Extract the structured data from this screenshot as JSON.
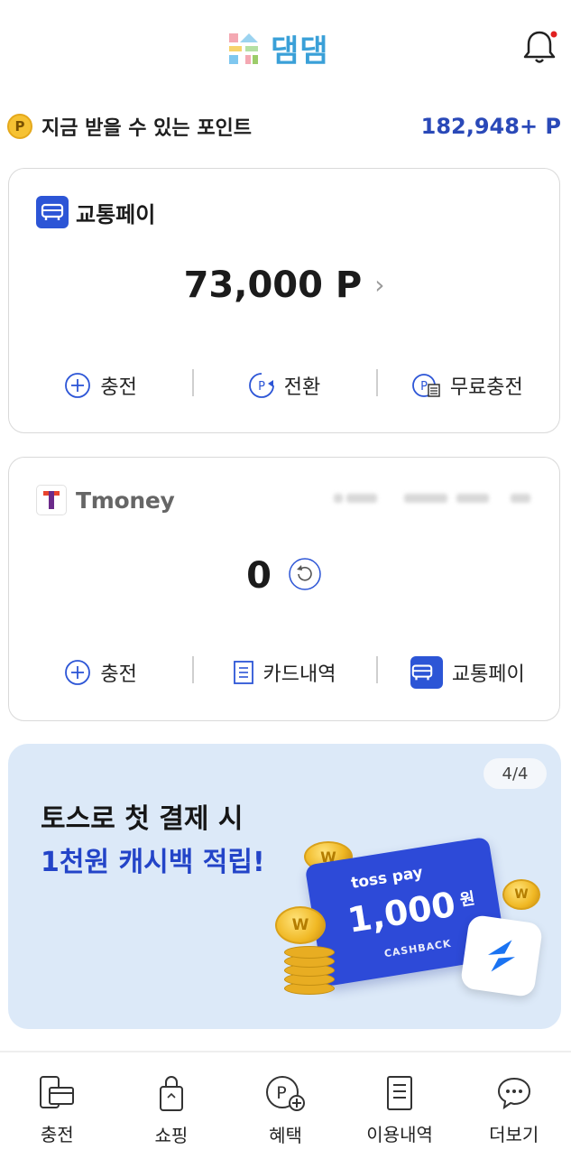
{
  "header": {
    "app_name": "댐댐"
  },
  "points": {
    "badge_letter": "P",
    "label": "지금 받을 수 있는 포인트",
    "value": "182,948+ P"
  },
  "transit_pay_card": {
    "name": "교통페이",
    "amount": "73,000 P",
    "actions": [
      {
        "label": "충전",
        "icon": "plus-circle-icon"
      },
      {
        "label": "전환",
        "icon": "point-convert-icon"
      },
      {
        "label": "무료충전",
        "icon": "free-charge-icon"
      }
    ]
  },
  "tmoney_card": {
    "brand": "Tmoney",
    "balance": "0",
    "actions": [
      {
        "label": "충전",
        "icon": "plus-circle-icon"
      },
      {
        "label": "카드내역",
        "icon": "document-icon"
      },
      {
        "label": "교통페이",
        "icon": "bus-icon"
      }
    ]
  },
  "banner": {
    "pager": "4/4",
    "line1": "토스로 첫 결제 시",
    "line2": "1천원 캐시백 적립!",
    "ticket_brand": "toss pay",
    "ticket_amount": "1,000",
    "ticket_unit": "원",
    "ticket_caption": "CASHBACK",
    "coin_symbol": "W"
  },
  "nav": [
    {
      "label": "충전",
      "icon": "charge-card-icon"
    },
    {
      "label": "쇼핑",
      "icon": "shopping-bag-icon"
    },
    {
      "label": "혜택",
      "icon": "benefit-point-icon"
    },
    {
      "label": "이용내역",
      "icon": "history-list-icon"
    },
    {
      "label": "더보기",
      "icon": "more-chat-icon"
    }
  ],
  "colors": {
    "brand_blue": "#2c55d6",
    "point_blue": "#2a49b8",
    "banner_bg": "#dce9f8",
    "notification_dot": "#e02020"
  }
}
